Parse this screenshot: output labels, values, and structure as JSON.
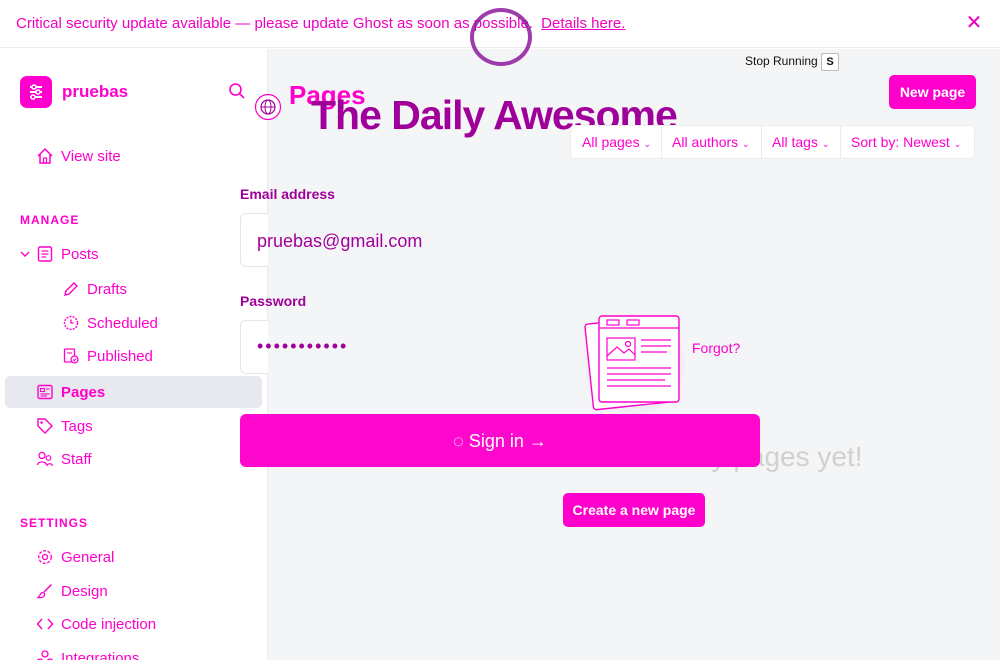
{
  "banner": {
    "message": "Critical security update available — please update Ghost as soon as possible.",
    "link_text": "Details here."
  },
  "sidebar": {
    "site_name": "pruebas",
    "view_site": "View site",
    "manage_heading": "MANAGE",
    "settings_heading": "SETTINGS",
    "items": {
      "posts": "Posts",
      "drafts": "Drafts",
      "scheduled": "Scheduled",
      "published": "Published",
      "pages": "Pages",
      "tags": "Tags",
      "staff": "Staff",
      "general": "General",
      "design": "Design",
      "code_injection": "Code injection",
      "integrations": "Integrations"
    }
  },
  "header": {
    "page_title": "Pages",
    "publication_title": "The Daily Awesome",
    "new_page": "New page"
  },
  "recorder": {
    "stop_text": "Stop Running",
    "stop_key": "S"
  },
  "filters": {
    "type": "All pages",
    "authors": "All authors",
    "tags": "All tags",
    "sort": "Sort by: Newest"
  },
  "signin": {
    "email_label": "Email address",
    "email_value": "pruebas@gmail.com",
    "password_label": "Password",
    "password_value": "•••••••••••",
    "forgot": "Forgot?",
    "button": "◌ Sign in →"
  },
  "empty_state": {
    "message": "You haven't created any pages yet!",
    "create_button": "Create a new page"
  },
  "colors": {
    "accent": "#ff00cc",
    "title_overlay": "#a0009a",
    "active_bg": "#e7e9ef"
  }
}
